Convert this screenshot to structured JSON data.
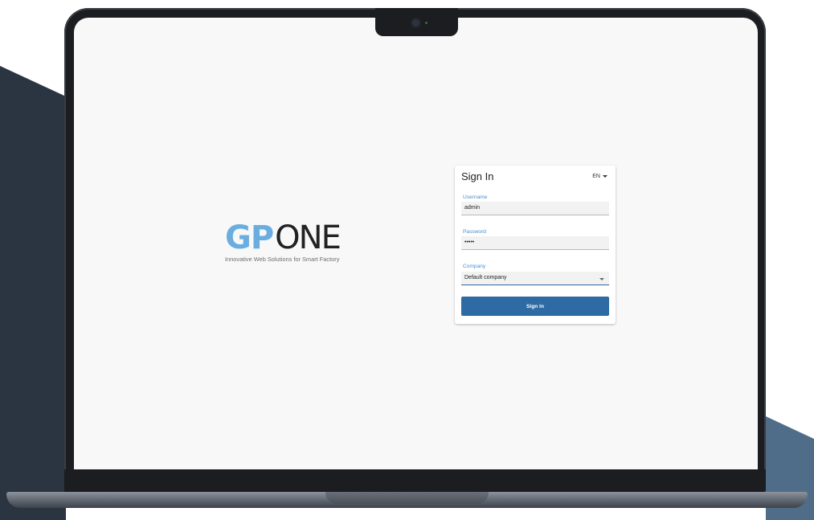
{
  "logo": {
    "brand_gp": "GP",
    "brand_one": "ONE",
    "tagline": "Innovative Web Solutions for Smart Factory"
  },
  "signin": {
    "title": "Sign In",
    "language": "EN",
    "username_label": "Username",
    "username_value": "admin",
    "password_label": "Password",
    "password_value": "•••••",
    "company_label": "Company",
    "company_value": "Default company",
    "button_label": "Sign In"
  },
  "colors": {
    "accent": "#2e6aa3",
    "label_blue": "#4a8fd1",
    "logo_blue": "#6aaee0",
    "screen_bg": "#f8f8f8",
    "bezel": "#1b1d21"
  },
  "icons": {
    "language_dropdown": "chevron-down-icon",
    "company_dropdown": "chevron-down-icon",
    "camera": "camera-icon"
  }
}
